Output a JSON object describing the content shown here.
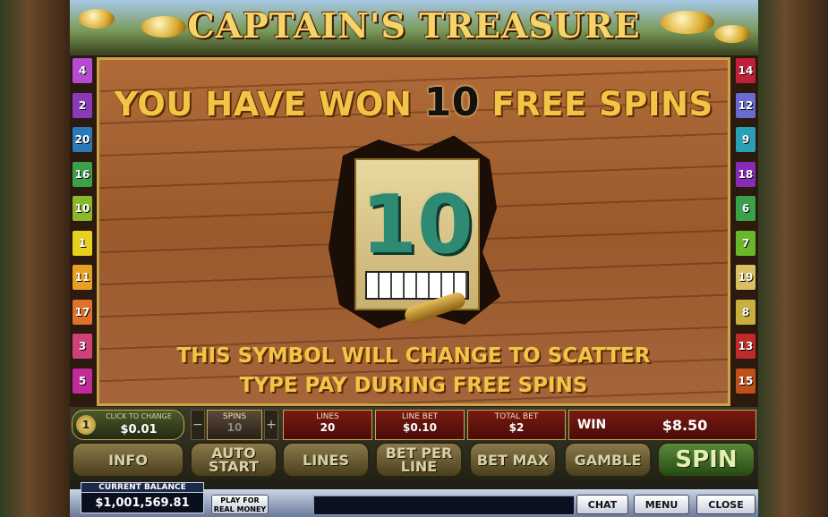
{
  "title": "CAPTAIN'S TREASURE",
  "board": {
    "won_prefix": "YOU HAVE WON",
    "won_count": "10",
    "won_suffix": "FREE SPINS",
    "symbol_value": "10",
    "message_line1": "THIS SYMBOL WILL CHANGE TO SCATTER",
    "message_line2": "TYPE PAY DURING FREE SPINS"
  },
  "left_stakes": [
    {
      "label": "4",
      "color": "#b64ad0"
    },
    {
      "label": "2",
      "color": "#8a3ab8"
    },
    {
      "label": "20",
      "color": "#2a7ab8"
    },
    {
      "label": "16",
      "color": "#3aa04a"
    },
    {
      "label": "10",
      "color": "#8ab82a"
    },
    {
      "label": "1",
      "color": "#e8d020"
    },
    {
      "label": "11",
      "color": "#e8a020"
    },
    {
      "label": "17",
      "color": "#e0702a"
    },
    {
      "label": "3",
      "color": "#d0407a"
    },
    {
      "label": "5",
      "color": "#c02a9a"
    }
  ],
  "right_stakes": [
    {
      "label": "14",
      "color": "#c0203a"
    },
    {
      "label": "12",
      "color": "#6a6ad0"
    },
    {
      "label": "9",
      "color": "#2aa0b8"
    },
    {
      "label": "18",
      "color": "#8a2ab8"
    },
    {
      "label": "6",
      "color": "#3aa04a"
    },
    {
      "label": "7",
      "color": "#6ab82a"
    },
    {
      "label": "19",
      "color": "#d8c060"
    },
    {
      "label": "8",
      "color": "#c8b040"
    },
    {
      "label": "13",
      "color": "#c02a2a"
    },
    {
      "label": "15",
      "color": "#c0501a"
    }
  ],
  "controls": {
    "coin_label": "CLICK TO CHANGE",
    "coin_value": "$0.01",
    "coin_badge": "1",
    "spins_label": "SPINS",
    "spins_value": "10",
    "minus": "−",
    "plus": "+",
    "lines_label": "LINES",
    "lines_value": "20",
    "linebet_label": "LINE BET",
    "linebet_value": "$0.10",
    "totalbet_label": "TOTAL BET",
    "totalbet_value": "$2",
    "win_label": "WIN",
    "win_value": "$8.50",
    "buttons": {
      "info": "INFO",
      "auto_start": "AUTO START",
      "lines": "LINES",
      "bet_per_line": "BET PER LINE",
      "bet_max": "BET MAX",
      "gamble": "GAMBLE",
      "spin": "SPIN"
    }
  },
  "bottom": {
    "balance_label": "CURRENT BALANCE",
    "balance_value": "$1,001,569.81",
    "real_money": "PLAY FOR REAL MONEY",
    "chat": "CHAT",
    "menu": "MENU",
    "close": "CLOSE"
  }
}
